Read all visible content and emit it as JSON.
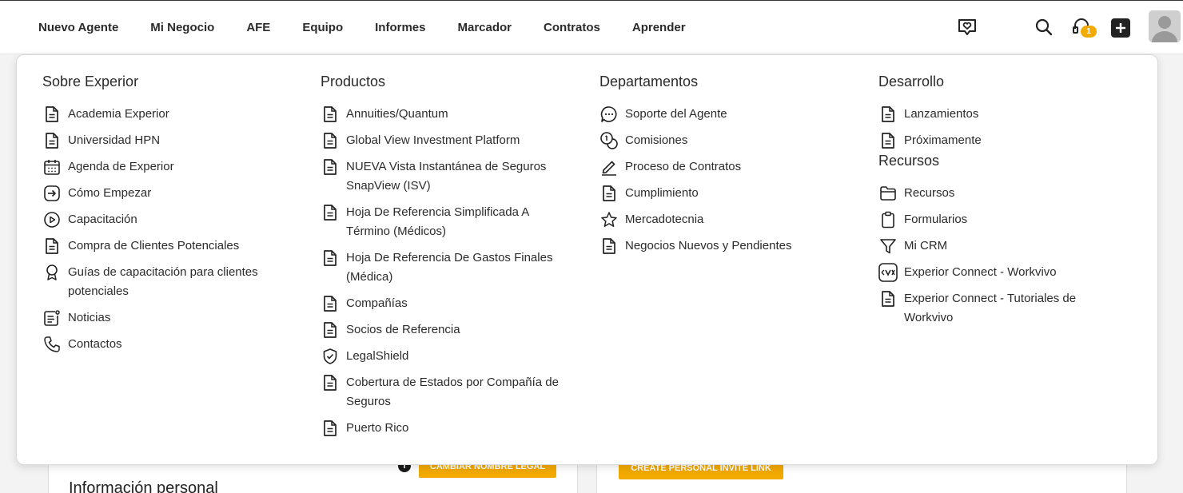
{
  "nav": {
    "items": [
      "Nuevo Agente",
      "Mi Negocio",
      "AFE",
      "Equipo",
      "Informes",
      "Marcador",
      "Contratos",
      "Aprender"
    ]
  },
  "header": {
    "notification_count": "1"
  },
  "menu": {
    "sobre": {
      "title": "Sobre Experior",
      "links": [
        {
          "label": "Academia Experior",
          "icon": "document-icon"
        },
        {
          "label": "Universidad HPN",
          "icon": "document-icon"
        },
        {
          "label": "Agenda de Experior",
          "icon": "calendar-icon"
        },
        {
          "label": "Cómo Empezar",
          "icon": "arrow-right-box-icon"
        },
        {
          "label": "Capacitación",
          "icon": "play-circle-icon"
        },
        {
          "label": "Compra de Clientes Potenciales",
          "icon": "document-icon"
        },
        {
          "label": "Guías de capacitación para clientes potenciales",
          "icon": "award-icon"
        },
        {
          "label": "Noticias",
          "icon": "news-icon"
        },
        {
          "label": "Contactos",
          "icon": "phone-icon"
        }
      ]
    },
    "productos": {
      "title": "Productos",
      "links": [
        {
          "label": "Annuities/Quantum",
          "icon": "document-icon"
        },
        {
          "label": "Global View Investment Platform",
          "icon": "document-icon"
        },
        {
          "label": "NUEVA Vista Instantánea de Seguros SnapView (ISV)",
          "icon": "document-icon"
        },
        {
          "label": "Hoja De Referencia Simplificada A Término (Médicos)",
          "icon": "document-icon"
        },
        {
          "label": "Hoja De Referencia De Gastos Finales (Médica)",
          "icon": "document-icon"
        },
        {
          "label": "Compañías",
          "icon": "document-icon"
        },
        {
          "label": "Socios de Referencia",
          "icon": "document-icon"
        },
        {
          "label": "LegalShield",
          "icon": "shield-check-icon"
        },
        {
          "label": "Cobertura de Estados por Compañía de Seguros",
          "icon": "document-icon"
        },
        {
          "label": "Puerto Rico",
          "icon": "document-icon"
        }
      ]
    },
    "departamentos": {
      "title": "Departamentos",
      "links": [
        {
          "label": "Soporte del Agente",
          "icon": "chat-icon"
        },
        {
          "label": "Comisiones",
          "icon": "coins-icon"
        },
        {
          "label": "Proceso de Contratos",
          "icon": "pen-icon"
        },
        {
          "label": "Cumplimiento",
          "icon": "document-icon"
        },
        {
          "label": "Mercadotecnia",
          "icon": "star-icon"
        },
        {
          "label": "Negocios Nuevos y Pendientes",
          "icon": "document-icon"
        }
      ]
    },
    "desarrollo": {
      "title": "Desarrollo",
      "links": [
        {
          "label": "Lanzamientos",
          "icon": "document-icon"
        },
        {
          "label": "Próximamente",
          "icon": "document-icon"
        }
      ]
    },
    "recursos": {
      "title": "Recursos",
      "links": [
        {
          "label": "Recursos",
          "icon": "folder-icon"
        },
        {
          "label": "Formularios",
          "icon": "clipboard-icon"
        },
        {
          "label": "Mi CRM",
          "icon": "funnel-icon"
        },
        {
          "label": "Experior Connect - Workvivo",
          "icon": "workvivo-icon"
        },
        {
          "label": "Experior Connect - Tutoriales de Workvivo",
          "icon": "document-icon"
        }
      ]
    }
  },
  "background": {
    "legal_name_button": "CAMBIAR NOMBRE LEGAL",
    "invite_button": "CREATE PERSONAL INVITE LINK",
    "section_title": "Información personal"
  },
  "colors": {
    "accent": "#f2a900",
    "text": "#2b2b2b"
  }
}
